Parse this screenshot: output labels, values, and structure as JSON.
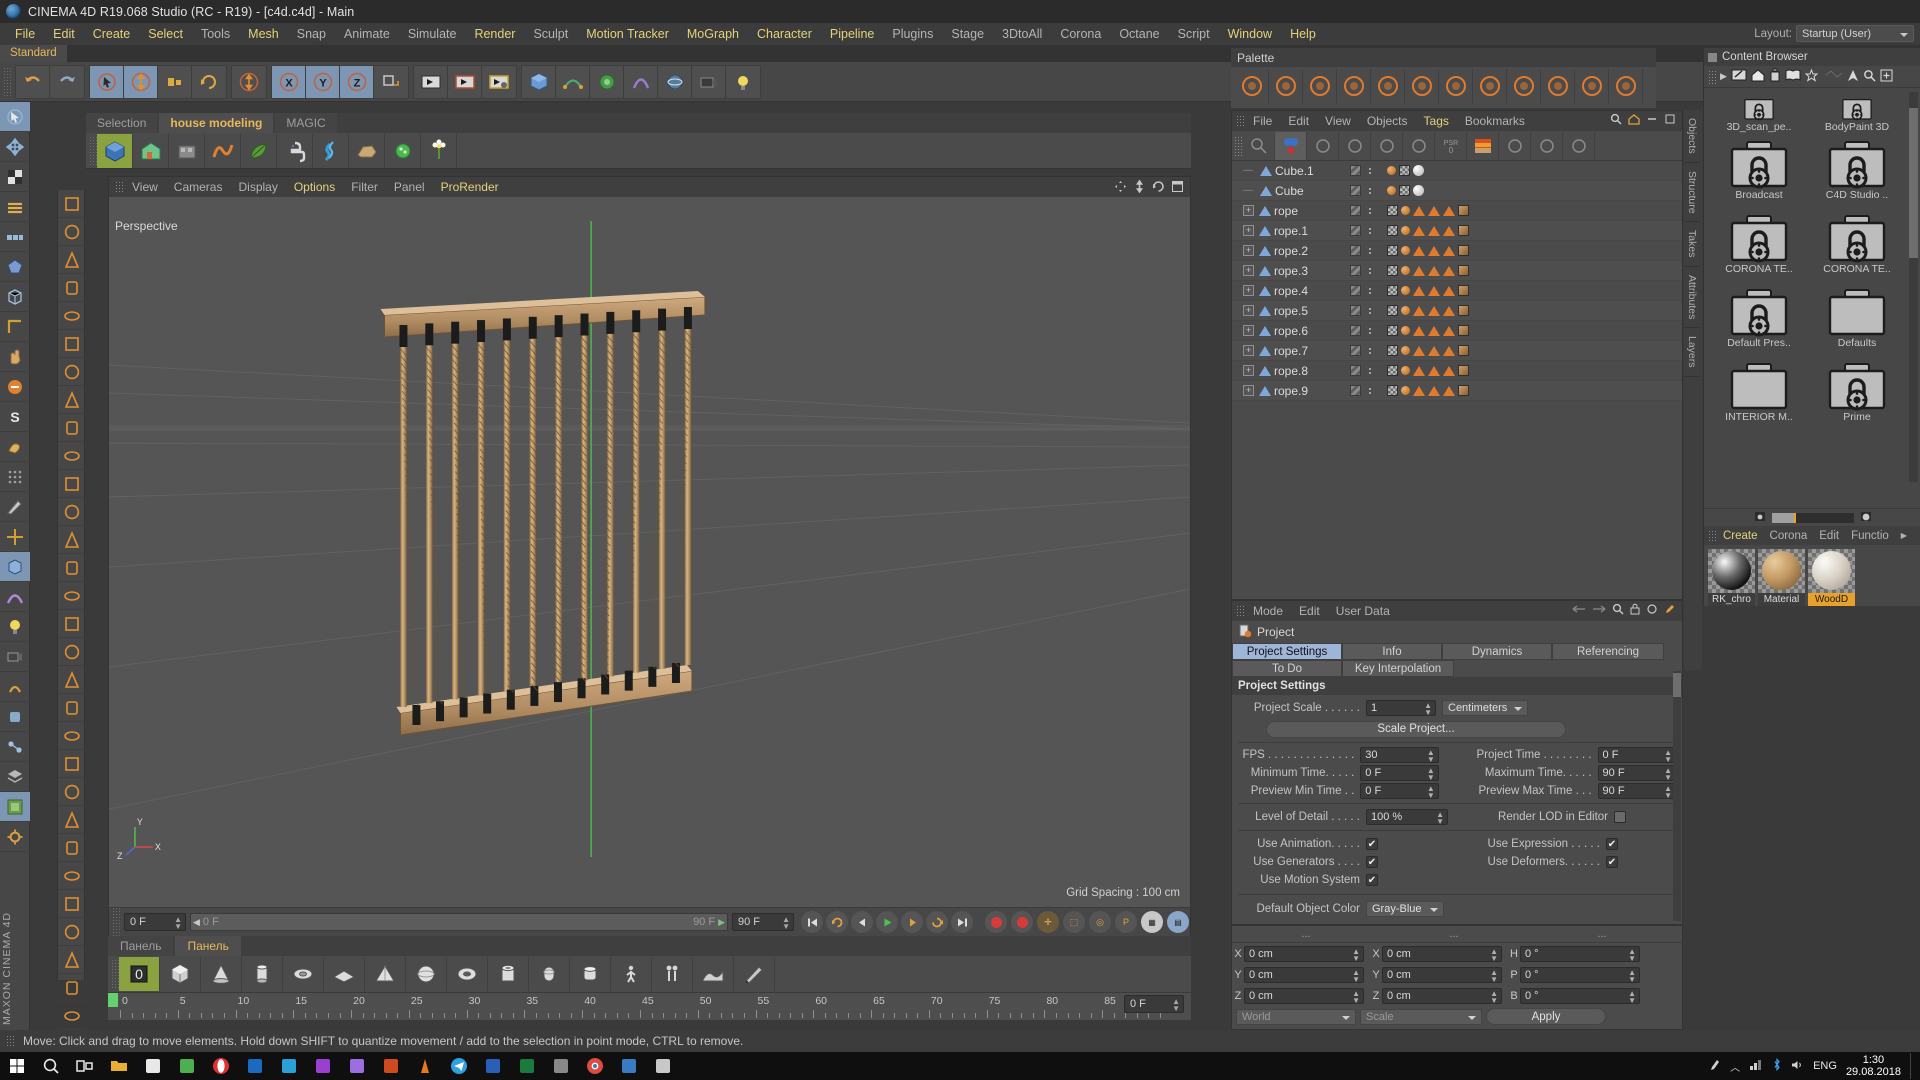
{
  "window": {
    "title": "CINEMA 4D R19.068 Studio (RC - R19) - [c4d.c4d] - Main",
    "logo": "c4d-logo-icon"
  },
  "menubar": {
    "items": [
      {
        "label": "File",
        "highlight": true
      },
      {
        "label": "Edit",
        "highlight": true
      },
      {
        "label": "Create",
        "highlight": true
      },
      {
        "label": "Select",
        "highlight": true
      },
      {
        "label": "Tools",
        "highlight": false
      },
      {
        "label": "Mesh",
        "highlight": true
      },
      {
        "label": "Snap",
        "highlight": false
      },
      {
        "label": "Animate",
        "highlight": false
      },
      {
        "label": "Simulate",
        "highlight": false
      },
      {
        "label": "Render",
        "highlight": true
      },
      {
        "label": "Sculpt",
        "highlight": false
      },
      {
        "label": "Motion Tracker",
        "highlight": true
      },
      {
        "label": "MoGraph",
        "highlight": true
      },
      {
        "label": "Character",
        "highlight": true
      },
      {
        "label": "Pipeline",
        "highlight": true
      },
      {
        "label": "Plugins",
        "highlight": false
      },
      {
        "label": "Stage",
        "highlight": false
      },
      {
        "label": "3DtoAll",
        "highlight": false
      },
      {
        "label": "Corona",
        "highlight": false
      },
      {
        "label": "Octane",
        "highlight": false
      },
      {
        "label": "Script",
        "highlight": false
      },
      {
        "label": "Window",
        "highlight": true
      },
      {
        "label": "Help",
        "highlight": true
      }
    ]
  },
  "layout": {
    "label": "Layout:",
    "value": "Startup (User)"
  },
  "standard_tab": {
    "label": "Standard"
  },
  "viewport_tabs": [
    {
      "label": "Selection",
      "active": false
    },
    {
      "label": "house modeling",
      "active": true
    },
    {
      "label": "MAGIC",
      "active": false
    }
  ],
  "viewport": {
    "menu": [
      {
        "label": "View",
        "highlight": false
      },
      {
        "label": "Cameras",
        "highlight": false
      },
      {
        "label": "Display",
        "highlight": false
      },
      {
        "label": "Options",
        "highlight": true
      },
      {
        "label": "Filter",
        "highlight": false
      },
      {
        "label": "Panel",
        "highlight": false
      },
      {
        "label": "ProRender",
        "highlight": true
      }
    ],
    "camera_label": "Perspective",
    "grid_spacing": "Grid Spacing : 100 cm",
    "axis_labels": {
      "x": "X",
      "y": "Y",
      "z": "Z"
    }
  },
  "timeline": {
    "current_frame": "0 F",
    "range_start": "0 F",
    "range_end": "90 F",
    "max_frame": "90 F",
    "end_field": "0 F",
    "ruler_ticks": [
      "0",
      "5",
      "10",
      "15",
      "20",
      "25",
      "30",
      "35",
      "40",
      "45",
      "50",
      "55",
      "60",
      "65",
      "70",
      "75",
      "80",
      "85",
      "90"
    ]
  },
  "panel_tabs": [
    {
      "label": "Панель",
      "active": false
    },
    {
      "label": "Панель",
      "active": true
    }
  ],
  "palette_panel": {
    "title": "Palette"
  },
  "object_manager": {
    "menu": [
      {
        "label": "File",
        "highlight": false
      },
      {
        "label": "Edit",
        "highlight": false
      },
      {
        "label": "View",
        "highlight": false
      },
      {
        "label": "Objects",
        "highlight": false
      },
      {
        "label": "Tags",
        "highlight": true
      },
      {
        "label": "Bookmarks",
        "highlight": false
      }
    ],
    "toolbar_icons": [
      "magnifier-icon",
      "two-spheres-icon",
      "globe-mesh-icon",
      "cube-arrow-icon",
      "rope-icon",
      "person-icon",
      "psr-icon",
      "spectrum-icon",
      "info-globe-icon",
      "sphere-tag-icon",
      "key-icon"
    ],
    "objects": [
      {
        "name": "Cube.1",
        "expandable": false,
        "tags": [
          "ball",
          "checker",
          "white-sphere"
        ]
      },
      {
        "name": "Cube",
        "expandable": false,
        "tags": [
          "ball",
          "checker",
          "white-sphere"
        ]
      },
      {
        "name": "rope",
        "expandable": true,
        "tags": [
          "checker",
          "ball",
          "triangle",
          "triangle",
          "triangle",
          "wood"
        ]
      },
      {
        "name": "rope.1",
        "expandable": true,
        "tags": [
          "checker",
          "ball",
          "triangle",
          "triangle",
          "triangle",
          "wood"
        ]
      },
      {
        "name": "rope.2",
        "expandable": true,
        "tags": [
          "checker",
          "ball",
          "triangle",
          "triangle",
          "triangle",
          "wood"
        ]
      },
      {
        "name": "rope.3",
        "expandable": true,
        "tags": [
          "checker",
          "ball",
          "triangle",
          "triangle",
          "triangle",
          "wood"
        ]
      },
      {
        "name": "rope.4",
        "expandable": true,
        "tags": [
          "checker",
          "ball",
          "triangle",
          "triangle",
          "triangle",
          "wood"
        ]
      },
      {
        "name": "rope.5",
        "expandable": true,
        "tags": [
          "checker",
          "ball",
          "triangle",
          "triangle",
          "triangle",
          "wood"
        ]
      },
      {
        "name": "rope.6",
        "expandable": true,
        "tags": [
          "checker",
          "ball",
          "triangle",
          "triangle",
          "triangle",
          "wood"
        ]
      },
      {
        "name": "rope.7",
        "expandable": true,
        "tags": [
          "checker",
          "ball",
          "triangle",
          "triangle",
          "triangle",
          "wood"
        ]
      },
      {
        "name": "rope.8",
        "expandable": true,
        "tags": [
          "checker",
          "ball",
          "triangle",
          "triangle",
          "triangle",
          "wood"
        ]
      },
      {
        "name": "rope.9",
        "expandable": true,
        "tags": [
          "checker",
          "ball",
          "triangle",
          "triangle",
          "triangle",
          "wood"
        ]
      }
    ]
  },
  "attribute_manager": {
    "menu": [
      {
        "label": "Mode"
      },
      {
        "label": "Edit"
      },
      {
        "label": "User Data"
      }
    ],
    "object_label": "Project",
    "tabs_row1": [
      {
        "label": "Project Settings",
        "active": true
      },
      {
        "label": "Info",
        "active": false
      },
      {
        "label": "Dynamics",
        "active": false
      },
      {
        "label": "Referencing",
        "active": false
      }
    ],
    "tabs_row2": [
      {
        "label": "To Do",
        "active": false
      },
      {
        "label": "Key Interpolation",
        "active": false
      }
    ],
    "section_title": "Project Settings",
    "fields": {
      "project_scale_label": "Project Scale . . . . . .",
      "project_scale_value": "1",
      "project_scale_unit": "Centimeters",
      "scale_project_button": "Scale Project...",
      "fps_label": "FPS . . . . . . . . . . . . . .",
      "fps_value": "30",
      "project_time_label": "Project Time . . . . . . . .",
      "project_time_value": "0 F",
      "minimum_time_label": "Minimum Time. . . . .",
      "minimum_time_value": "0 F",
      "maximum_time_label": "Maximum Time. . . . .",
      "maximum_time_value": "90 F",
      "preview_min_label": "Preview Min Time . .",
      "preview_min_value": "0 F",
      "preview_max_label": "Preview Max Time . . .",
      "preview_max_value": "90 F",
      "lod_label": "Level of Detail . . . . .",
      "lod_value": "100 %",
      "render_lod_label": "Render LOD in Editor",
      "render_lod_checked": false,
      "use_animation_label": "Use Animation. . . . .",
      "use_animation_checked": true,
      "use_expression_label": "Use Expression . . . . .",
      "use_expression_checked": true,
      "use_generators_label": "Use Generators . . . .",
      "use_generators_checked": true,
      "use_deformers_label": "Use Deformers. . . . . .",
      "use_deformers_checked": true,
      "use_motion_label": "Use Motion System",
      "use_motion_checked": true,
      "default_color_label": "Default Object Color",
      "default_color_value": "Gray-Blue"
    }
  },
  "coordinates": {
    "headers": [
      "...",
      "...",
      "..."
    ],
    "rows": [
      {
        "axis": "X",
        "pos": "0 cm",
        "axis2": "X",
        "size": "0 cm",
        "axis3": "H",
        "rot": "0 °"
      },
      {
        "axis": "Y",
        "pos": "0 cm",
        "axis2": "Y",
        "size": "0 cm",
        "axis3": "P",
        "rot": "0 °"
      },
      {
        "axis": "Z",
        "pos": "0 cm",
        "axis2": "Z",
        "size": "0 cm",
        "axis3": "B",
        "rot": "0 °"
      }
    ],
    "coord_system": "World",
    "scale_mode": "Scale",
    "apply_button": "Apply"
  },
  "content_browser": {
    "title": "Content Browser",
    "tool_icons": [
      "pencil-icon",
      "home-icon",
      "trash-icon",
      "book-icon",
      "star-icon",
      "preview-icon",
      "up-arrow-icon",
      "search-icon",
      "new-icon"
    ],
    "items": [
      {
        "label": "3D_scan_pe..",
        "locked": true,
        "partial": true
      },
      {
        "label": "BodyPaint 3D",
        "locked": true,
        "partial": true
      },
      {
        "label": "Broadcast",
        "locked": true
      },
      {
        "label": "C4D Studio ..",
        "locked": true
      },
      {
        "label": "CORONA  TE..",
        "locked": true
      },
      {
        "label": "CORONA TE..",
        "locked": true
      },
      {
        "label": "Default Pres..",
        "locked": true
      },
      {
        "label": "Defaults",
        "locked": false
      },
      {
        "label": "INTERIOR M..",
        "locked": false
      },
      {
        "label": "Prime",
        "locked": true
      }
    ]
  },
  "material_manager": {
    "menu": [
      {
        "label": "Create",
        "highlight": true
      },
      {
        "label": "Corona",
        "highlight": false
      },
      {
        "label": "Edit",
        "highlight": false
      },
      {
        "label": "Functio",
        "highlight": false
      }
    ],
    "materials": [
      {
        "name": "RK_chro",
        "selected": false,
        "kind": "chrome"
      },
      {
        "name": "Material",
        "selected": false,
        "kind": "wood"
      },
      {
        "name": "WoodD",
        "selected": true,
        "kind": "white"
      }
    ]
  },
  "right_vtabs": [
    "Objects",
    "Structure",
    "Takes",
    "Attributes",
    "Layers"
  ],
  "statusbar": {
    "text": "Move: Click and drag to move elements. Hold down SHIFT to quantize movement / add to the selection in point mode, CTRL to remove."
  },
  "taskbar": {
    "apps": [
      "start-icon",
      "search-icon",
      "taskview-icon",
      "explorer-icon",
      "store-icon",
      "vegas-icon",
      "opera-icon",
      "edge-icon",
      "photoshop-icon",
      "premiere-icon",
      "aftereffects-icon",
      "powerpoint-icon",
      "vlc-icon",
      "telegram-icon",
      "word-icon",
      "excel-icon",
      "unknown-icon",
      "chrome-icon",
      "c4d-icon",
      "camera-icon"
    ],
    "tray": [
      "pen-icon",
      "hidden-icons-icon",
      "network-icon",
      "bluetooth-icon",
      "volume-icon"
    ],
    "language": "ENG",
    "time": "1:30",
    "date": "29.08.2018"
  },
  "brand": {
    "vertical_text": "MAXON CINEMA 4D"
  },
  "colors": {
    "accent_yellow": "#e3d27a",
    "accent_orange": "#e8a12a",
    "tab_active_blue": "#9fb5d8",
    "selected_green": "#8aa23f",
    "panel_bg": "#4b4b4b",
    "dark_bg": "#3c3c3c"
  }
}
